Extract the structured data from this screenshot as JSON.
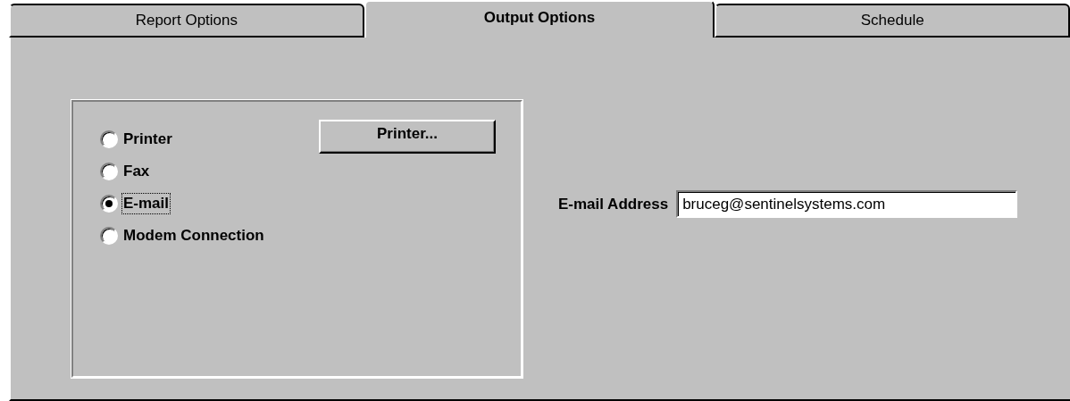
{
  "tabs": [
    {
      "label": "Report Options",
      "selected": false
    },
    {
      "label": "Output Options",
      "selected": true
    },
    {
      "label": "Schedule",
      "selected": false
    }
  ],
  "output_group": {
    "options": [
      {
        "label": "Printer",
        "selected": false,
        "focused": false
      },
      {
        "label": "Fax",
        "selected": false,
        "focused": false
      },
      {
        "label": "E-mail",
        "selected": true,
        "focused": true
      },
      {
        "label": "Modem Connection",
        "selected": false,
        "focused": false
      }
    ],
    "printer_button": "Printer..."
  },
  "email_address": {
    "label": "E-mail Address",
    "value": "bruceg@sentinelsystems.com"
  }
}
